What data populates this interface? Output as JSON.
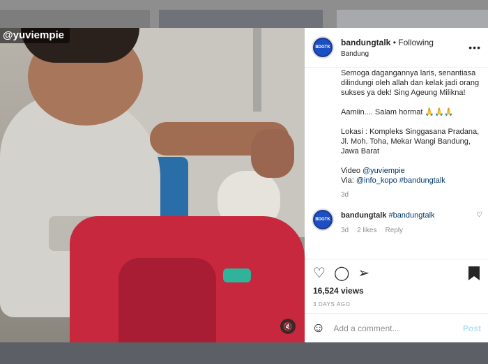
{
  "post": {
    "username": "bandungtalk",
    "separator": "•",
    "follow_status": "Following",
    "location": "Bandung",
    "more_label": "•••",
    "watermark": "@yuviempie",
    "caption": "Semoga dagangannya laris, senantiasa dilindungi oleh allah dan kelak jadi orang sukses ya dek! Sing Ageung Milikna!\n\nAamiin.... Salam hormat 🙏🙏🙏\n\nLokasi : Kompleks Singgasana Pradana, Jl. Moh. Toha, Mekar Wangi Bandung, Jawa Barat\n\nVideo ",
    "caption_mention": "@yuviempie",
    "caption_via_label": "Via: ",
    "caption_via_tags": "@info_kopo #bandungtalk",
    "caption_age": "3d",
    "views": "16,524 views",
    "date": "3 DAYS AGO"
  },
  "reply": {
    "username": "bandungtalk",
    "text": "#bandungtalk",
    "age": "3d",
    "likes": "2 likes",
    "reply_label": "Reply"
  },
  "avatar_label": "BDGTK",
  "composer": {
    "placeholder": "Add a comment...",
    "post_label": "Post"
  },
  "icons": {
    "like": "heart-icon",
    "comment": "comment-icon",
    "share": "paper-plane-icon",
    "save": "bookmark-icon",
    "emoji": "smiley-icon",
    "mute": "speaker-muted-icon",
    "more": "more-horizontal-icon"
  },
  "colors": {
    "text": "#262626",
    "secondary": "#8e8e8e",
    "link": "#00376b",
    "post_disabled": "#b2dffc",
    "backpack": "#c8283e"
  }
}
